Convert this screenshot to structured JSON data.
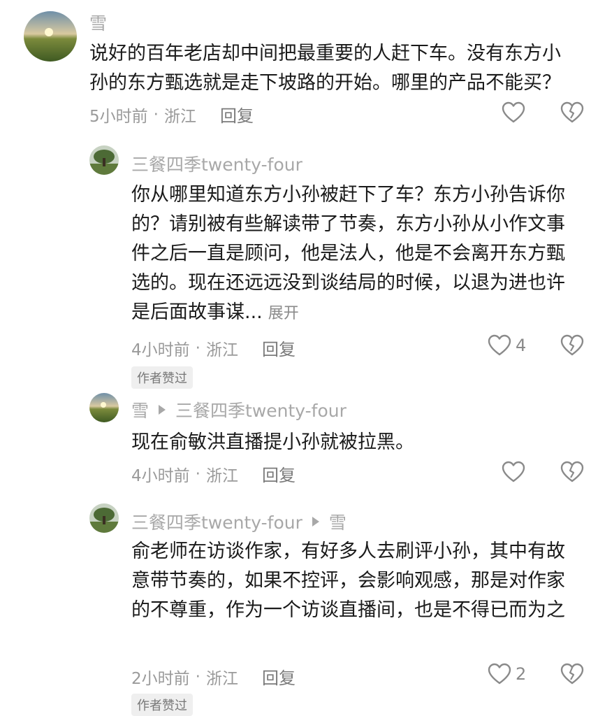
{
  "comments": [
    {
      "author": "雪",
      "text": "说好的百年老店却中间把最重要的人赶下车。没有东方小孙的东方甄选就是走下坡路的开始。哪里的产品不能买？",
      "time": "5小时前",
      "location": "浙江",
      "reply_label": "回复"
    },
    {
      "author": "三餐四季twenty-four",
      "text": "你从哪里知道东方小孙被赶下了车？东方小孙告诉你的？请别被有些解读带了节奏，东方小孙从小作文事件之后一直是顾问，他是法人，他是不会离开东方甄选的。现在还远远没到谈结局的时候，以退为进也许是后面故事谋...",
      "expand_label": "展开",
      "time": "4小时前",
      "location": "浙江",
      "reply_label": "回复",
      "like_count": "4",
      "badge": "作者赞过"
    },
    {
      "author": "雪",
      "reply_to": "三餐四季twenty-four",
      "text": "现在俞敏洪直播提小孙就被拉黑。",
      "time": "4小时前",
      "location": "浙江",
      "reply_label": "回复"
    },
    {
      "author": "三餐四季twenty-four",
      "reply_to": "雪",
      "text": "俞老师在访谈作家，有好多人去刷评小孙，其中有故意带节奏的，如果不控评，会影响观感，那是对作家的不尊重，作为一个访谈直播间，也是不得已而为之",
      "time": "2小时前",
      "location": "浙江",
      "reply_label": "回复",
      "like_count": "2",
      "badge": "作者赞过"
    }
  ],
  "separator": "·",
  "colors": {
    "text": "#1a1a1a",
    "meta": "#9a9a9a",
    "icon": "#8a8a8a",
    "badge_bg": "#efefef"
  },
  "icons": {
    "like": "heart-outline-icon",
    "dislike": "broken-heart-icon"
  }
}
